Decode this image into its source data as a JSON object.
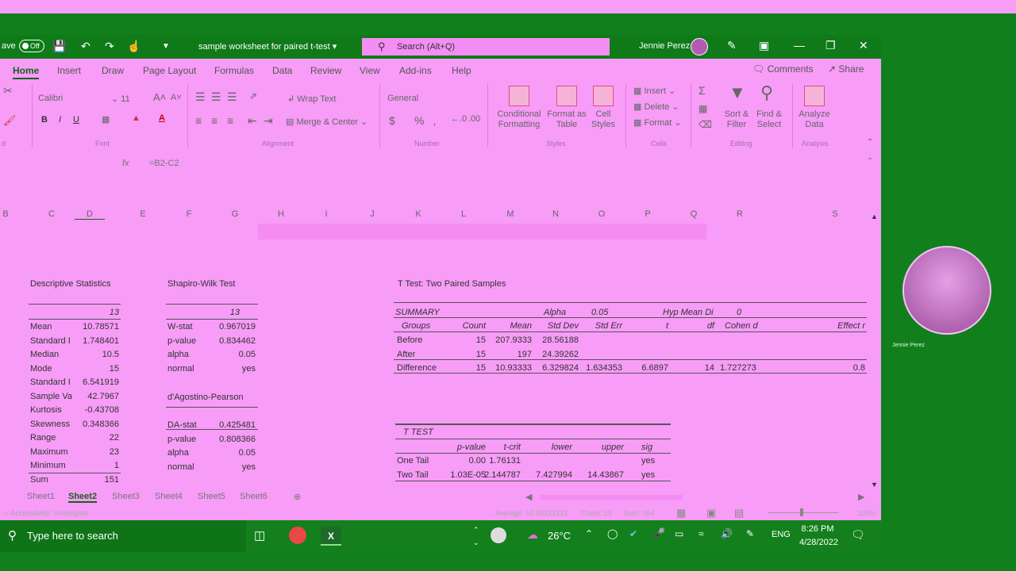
{
  "titlebar": {
    "autosave_label": "ave",
    "autosave_state": "Off",
    "doc_title": "sample worksheet for paired t-test",
    "search_placeholder": "Search (Alt+Q)",
    "user_name": "Jennie Perez"
  },
  "tabs": [
    "Home",
    "Insert",
    "Draw",
    "Page Layout",
    "Formulas",
    "Data",
    "Review",
    "View",
    "Add-ins",
    "Help"
  ],
  "comments_label": "Comments",
  "share_label": "Share",
  "ribbon": {
    "font_name": "Calibri",
    "font_size": "11",
    "wrap_text": "Wrap Text",
    "merge_center": "Merge & Center",
    "number_format": "General",
    "conditional_formatting": "Conditional Formatting",
    "format_as_table": "Format as Table",
    "cell_styles": "Cell Styles",
    "insert": "Insert",
    "delete": "Delete",
    "format": "Format",
    "sort_filter": "Sort & Filter",
    "find_select": "Find & Select",
    "analyze_data": "Analyze Data",
    "groups": [
      "d",
      "Font",
      "Alignment",
      "Number",
      "Styles",
      "Cells",
      "Editing",
      "Analysis"
    ]
  },
  "formula_bar": {
    "fx": "fx",
    "formula": "=B2-C2"
  },
  "columns": [
    "B",
    "C",
    "D",
    "E",
    "F",
    "G",
    "H",
    "I",
    "J",
    "K",
    "L",
    "M",
    "N",
    "O",
    "P",
    "Q",
    "R",
    "S"
  ],
  "desc": {
    "title": "Descriptive Statistics",
    "n": "13",
    "rows": [
      [
        "Mean",
        "10.78571"
      ],
      [
        "Standard I",
        "1.748401"
      ],
      [
        "Median",
        "10.5"
      ],
      [
        "Mode",
        "15"
      ],
      [
        "Standard I",
        "6.541919"
      ],
      [
        "Sample Va",
        "42.7967"
      ],
      [
        "Kurtosis",
        "-0.43708"
      ],
      [
        "Skewness",
        "0.348366"
      ],
      [
        "Range",
        "22"
      ],
      [
        "Maximum",
        "23"
      ],
      [
        "Minimum",
        "1"
      ],
      [
        "Sum",
        "151"
      ]
    ]
  },
  "shapiro": {
    "title": "Shapiro-Wilk Test",
    "n": "13",
    "rows": [
      [
        "W-stat",
        "0.967019"
      ],
      [
        "p-value",
        "0.834462"
      ],
      [
        "alpha",
        "0.05"
      ],
      [
        "normal",
        "yes"
      ]
    ]
  },
  "dagostino": {
    "title": "d'Agostino-Pearson",
    "rows": [
      [
        "DA-stat",
        "0.425481"
      ],
      [
        "p-value",
        "0.808366"
      ],
      [
        "alpha",
        "0.05"
      ],
      [
        "normal",
        "yes"
      ]
    ]
  },
  "ttest": {
    "title": "T Test: Two Paired Samples",
    "summary_label": "SUMMARY",
    "alpha_label": "Alpha",
    "alpha": "0.05",
    "hyp_label": "Hyp Mean Di",
    "hyp": "0",
    "headers": [
      "Groups",
      "Count",
      "Mean",
      "Std Dev",
      "Std Err",
      "t",
      "df",
      "Cohen d",
      "Effect r"
    ],
    "rows": [
      [
        "Before",
        "15",
        "207.9333",
        "28.56188",
        "",
        "",
        "",
        "",
        ""
      ],
      [
        "After",
        "15",
        "197",
        "24.39262",
        "",
        "",
        "",
        "",
        ""
      ],
      [
        "Difference",
        "15",
        "10.93333",
        "6.329824",
        "1.634353",
        "6.6897",
        "14",
        "1.727273",
        "0.8"
      ]
    ],
    "test_label": "T TEST",
    "test_headers": [
      "p-value",
      "t-crit",
      "lower",
      "upper",
      "sig"
    ],
    "test_rows": [
      [
        "One Tail",
        "0.00",
        "1.76131",
        "",
        "",
        "yes"
      ],
      [
        "Two Tail",
        "1.03E-05",
        "2.144787",
        "7.427994",
        "14.43867",
        "yes"
      ]
    ]
  },
  "sheets": [
    "Sheet1",
    "Sheet2",
    "Sheet3",
    "Sheet4",
    "Sheet5",
    "Sheet6"
  ],
  "active_sheet": "Sheet2",
  "status": {
    "accessibility": "Accessibility: Investigate",
    "average": "Average: 10.93333333",
    "count": "Count: 15",
    "sum": "Sum: 164",
    "zoom": "100%"
  },
  "taskbar": {
    "search_placeholder": "Type here to search",
    "weather": "26°C",
    "language": "ENG",
    "time": "8:26 PM",
    "date": "4/28/2022"
  },
  "video_caption": "Jennie Perez"
}
